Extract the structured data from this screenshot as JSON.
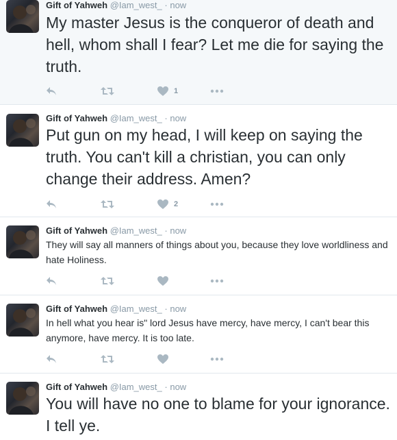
{
  "tweets": [
    {
      "name": "Gift of Yahweh",
      "handle": "@Iam_west_",
      "dot": "·",
      "time": "now",
      "text": "My master Jesus is the conqueror of death and hell, whom shall I fear? Let me die for saying the truth.",
      "like_count": "1"
    },
    {
      "name": "Gift of Yahweh",
      "handle": "@Iam_west_",
      "dot": "·",
      "time": "now",
      "text": "Put gun on my head, I  will keep on saying the truth. You can't kill a christian, you can only change their address. Amen?",
      "like_count": "2"
    },
    {
      "name": "Gift of Yahweh",
      "handle": "@Iam_west_",
      "dot": "·",
      "time": "now",
      "text": "They will say all manners of things about you, because they love worldliness and hate Holiness.",
      "like_count": ""
    },
    {
      "name": "Gift of Yahweh",
      "handle": "@Iam_west_",
      "dot": "·",
      "time": "now",
      "text": "In hell what you hear is\" lord Jesus have mercy, have mercy, I can't bear this anymore, have mercy. It is too late.",
      "like_count": ""
    },
    {
      "name": "Gift of Yahweh",
      "handle": "@Iam_west_",
      "dot": "·",
      "time": "now",
      "text": "You will have no one to blame for your ignorance. I tell ye.",
      "like_count": ""
    }
  ],
  "icons": {
    "reply": "reply-icon",
    "retweet": "retweet-icon",
    "like": "heart-icon",
    "more": "more-icon"
  },
  "colors": {
    "name": "#292f33",
    "meta": "#8899a6",
    "action": "#aab8c2",
    "divider": "#e1e8ed",
    "highlight_bg": "#f5f8fa"
  }
}
